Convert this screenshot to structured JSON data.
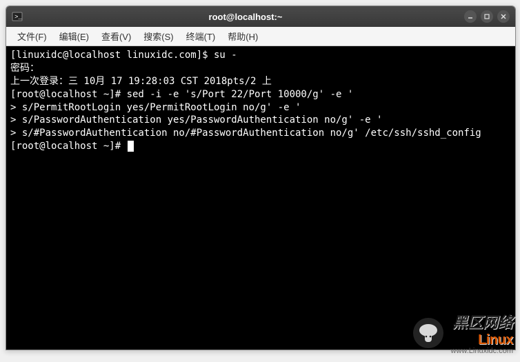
{
  "window": {
    "title": "root@localhost:~"
  },
  "menu": {
    "file": "文件(F)",
    "edit": "编辑(E)",
    "view": "查看(V)",
    "search": "搜索(S)",
    "terminal": "终端(T)",
    "help": "帮助(H)"
  },
  "terminal": {
    "lines": [
      "[linuxidc@localhost linuxidc.com]$ su -",
      "密码：",
      "上一次登录：三 10月 17 19:28:03 CST 2018pts/2 上",
      "[root@localhost ~]# sed -i -e 's/Port 22/Port 10000/g' -e '",
      "> s/PermitRootLogin yes/PermitRootLogin no/g' -e '",
      "> s/PasswordAuthentication yes/PasswordAuthentication no/g' -e '",
      "> s/#PasswordAuthentication no/#PasswordAuthentication no/g' /etc/ssh/sshd_config",
      "[root@localhost ~]# "
    ]
  },
  "watermark": {
    "cn": "黑区网络",
    "brand": "Linux",
    "url": "www.Linuxidc.com"
  }
}
